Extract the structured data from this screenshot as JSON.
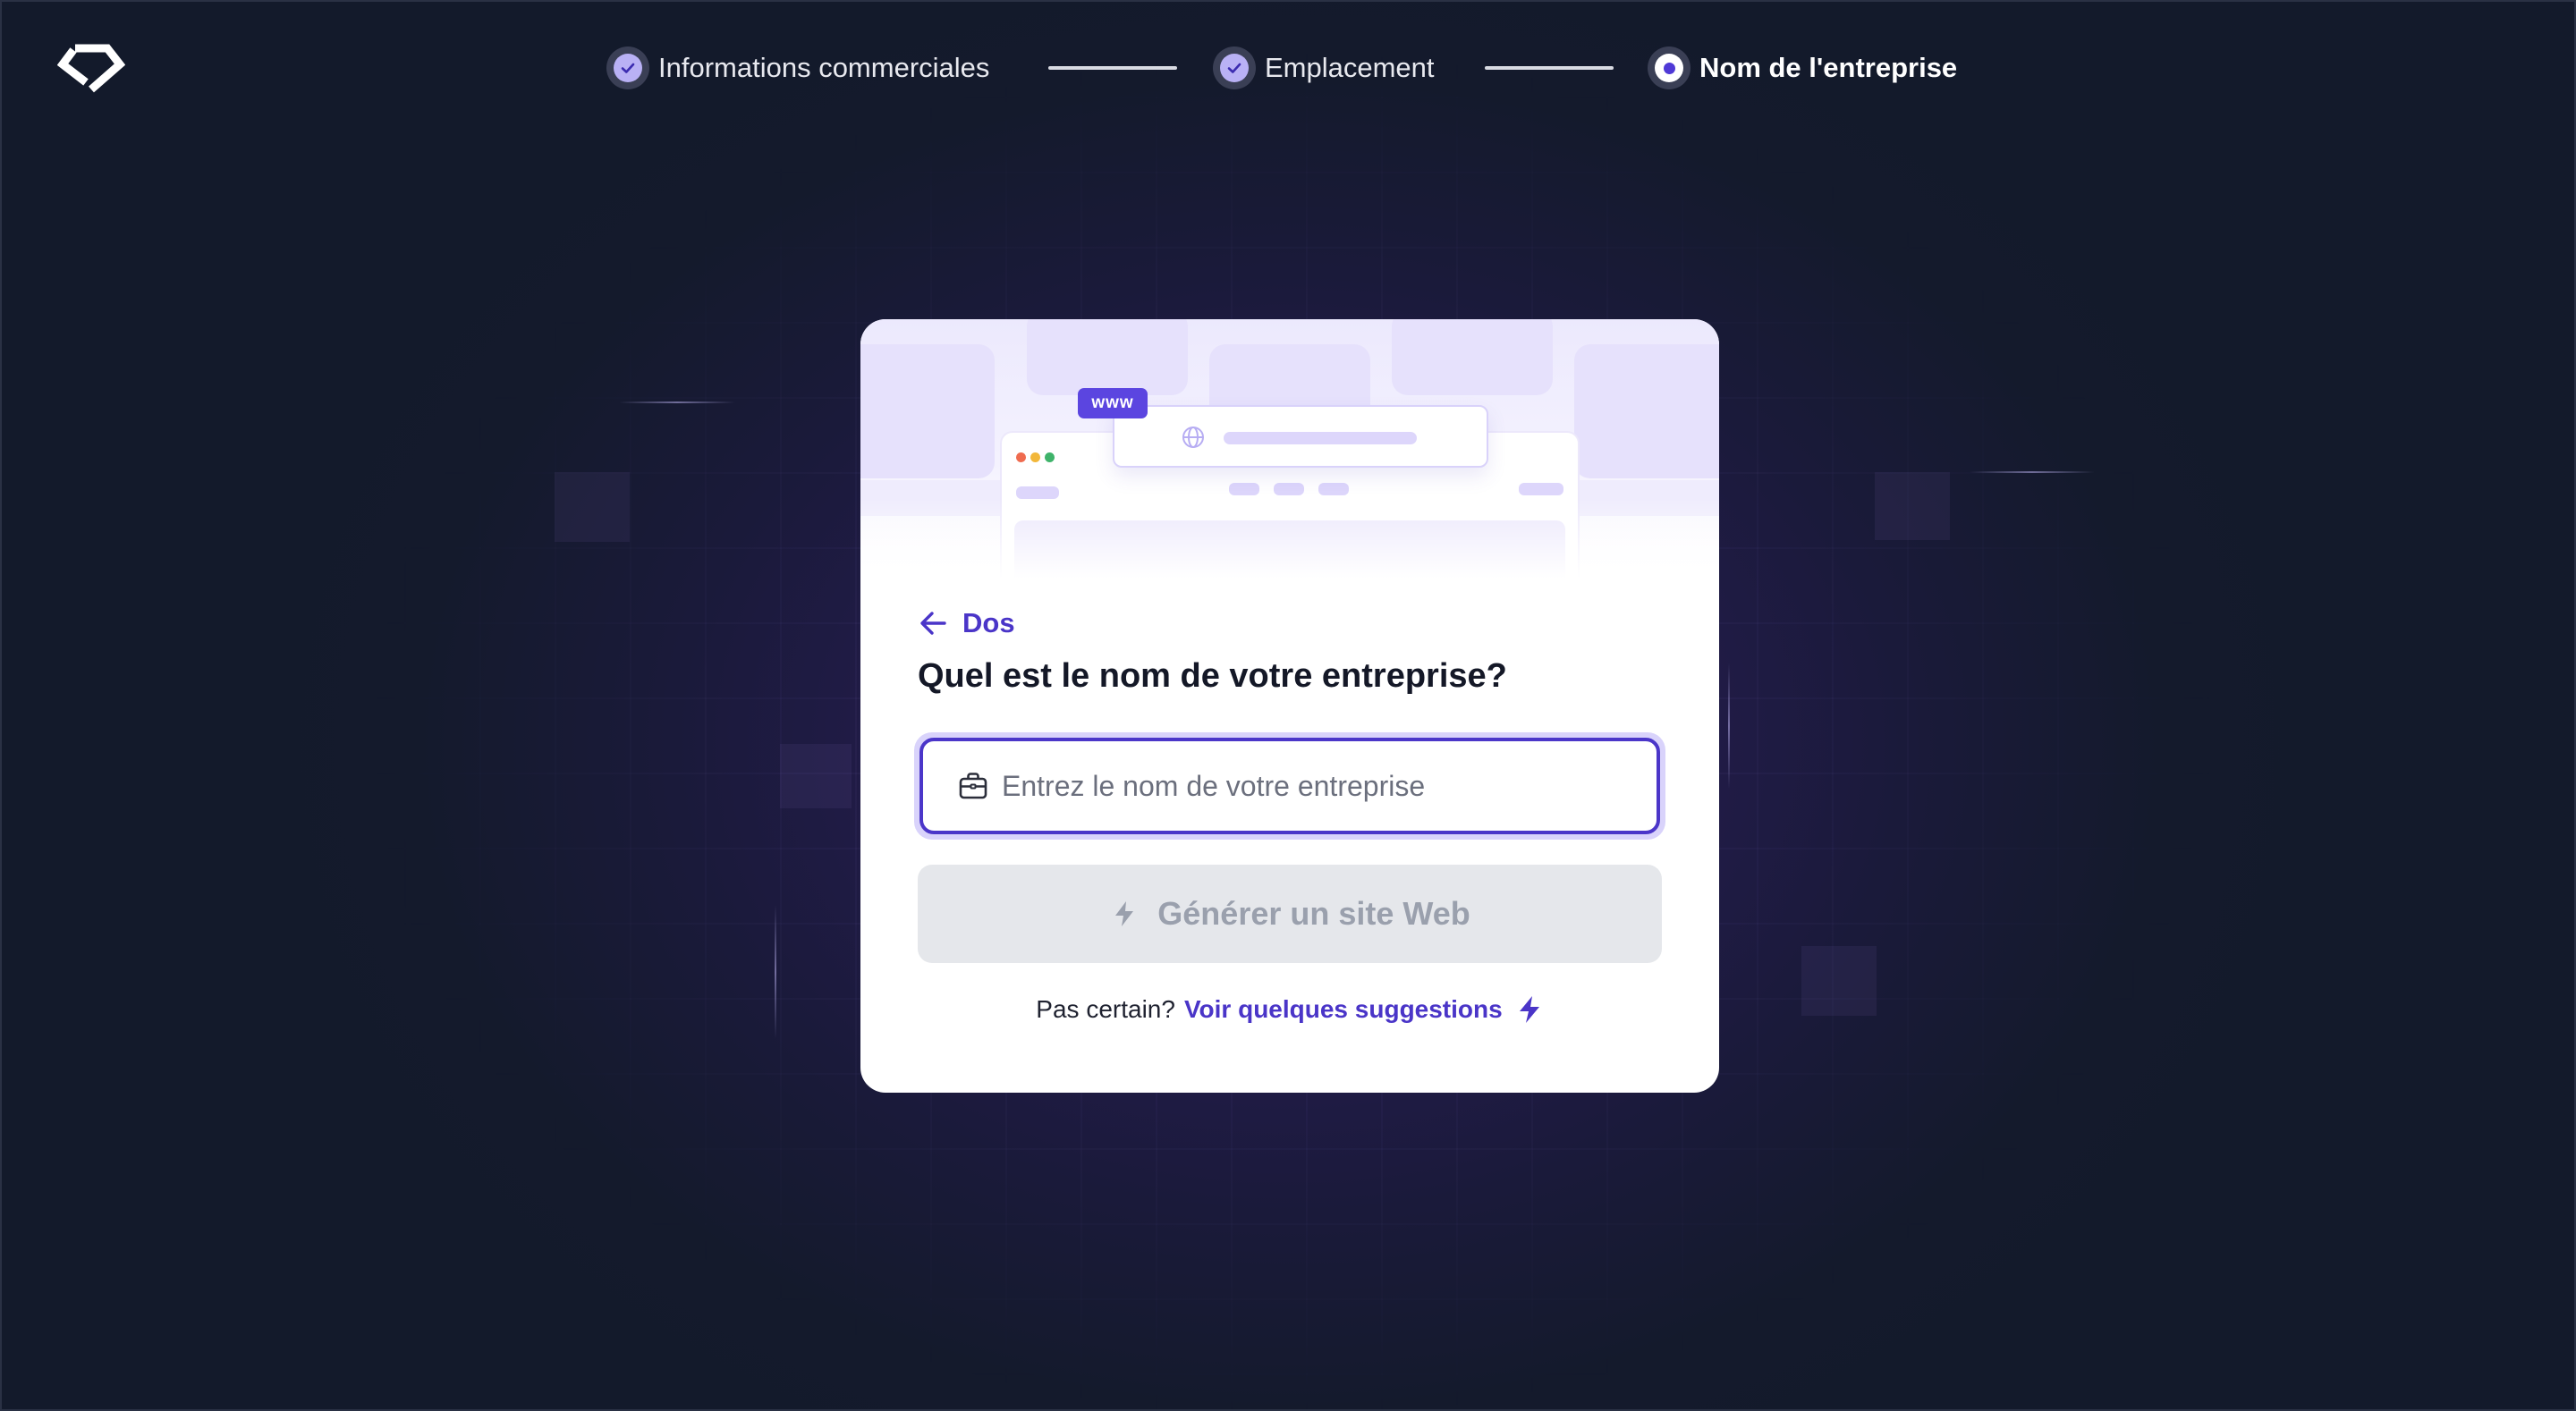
{
  "stepper": {
    "steps": [
      {
        "label": "Informations commerciales",
        "state": "complete"
      },
      {
        "label": "Emplacement",
        "state": "complete"
      },
      {
        "label": "Nom de l'entreprise",
        "state": "current"
      }
    ]
  },
  "card": {
    "hero_badge": "www",
    "back_label": "Dos",
    "question": "Quel est le nom de votre entreprise?",
    "business_name_input": {
      "value": "",
      "placeholder": "Entrez le nom de votre entreprise"
    },
    "generate_button_label": "Générer un site Web",
    "suggestion_prompt": "Pas certain?",
    "suggestion_link": "Voir quelques suggestions"
  },
  "colors": {
    "accent": "#4a35c8",
    "step_complete": "#b9b1f5",
    "background": "#131a2b",
    "button_disabled": "#e5e7eb"
  },
  "icons": {
    "logo": "diamond-logo-icon",
    "step_complete": "check-icon",
    "step_current": "radio-dot-icon",
    "back": "arrow-left-icon",
    "input": "briefcase-icon",
    "generate": "bolt-icon",
    "suggest": "bolt-icon",
    "hero": "globe-icon"
  }
}
